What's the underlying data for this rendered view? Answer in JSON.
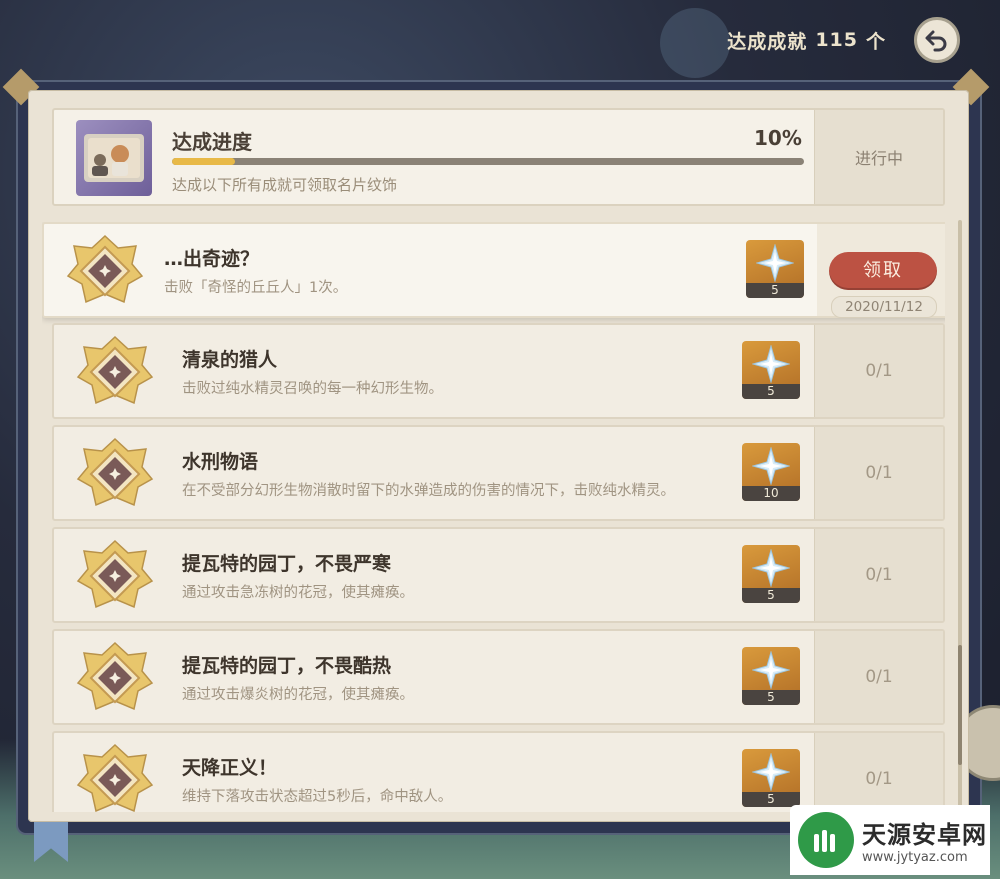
{
  "header": {
    "achieved_label": "达成成就",
    "achieved_count": "115",
    "achieved_unit": "个",
    "back_icon": "back-arrow-icon"
  },
  "progress": {
    "title": "达成进度",
    "percent_text": "10%",
    "percent_value": 0.1,
    "description": "达成以下所有成就可领取名片纹饰",
    "status": "进行中"
  },
  "achievements": [
    {
      "title": "…出奇迹？",
      "description": "击败「奇怪的丘丘人」1次。",
      "reward_count": "5",
      "status": "",
      "claim_label": "领取",
      "date": "2020/11/12"
    },
    {
      "title": "清泉的猎人",
      "description": "击败过纯水精灵召唤的每一种幻形生物。",
      "reward_count": "5",
      "status": "0/1"
    },
    {
      "title": "水刑物语",
      "description": "在不受部分幻形生物消散时留下的水弹造成的伤害的情况下，击败纯水精灵。",
      "reward_count": "10",
      "status": "0/1"
    },
    {
      "title": "提瓦特的园丁，不畏严寒",
      "description": "通过攻击急冻树的花冠，使其瘫痪。",
      "reward_count": "5",
      "status": "0/1"
    },
    {
      "title": "提瓦特的园丁，不畏酷热",
      "description": "通过攻击爆炎树的花冠，使其瘫痪。",
      "reward_count": "5",
      "status": "0/1"
    },
    {
      "title": "天降正义！",
      "description": "维持下落攻击状态超过5秒后，命中敌人。",
      "reward_count": "5",
      "status": "0/1"
    }
  ],
  "watermark": {
    "title": "天源安卓网",
    "url": "www.jytyaz.com"
  },
  "colors": {
    "accent_gold": "#e8b947",
    "claim_red": "#bc5243",
    "panel_bg": "#eae3d5"
  }
}
